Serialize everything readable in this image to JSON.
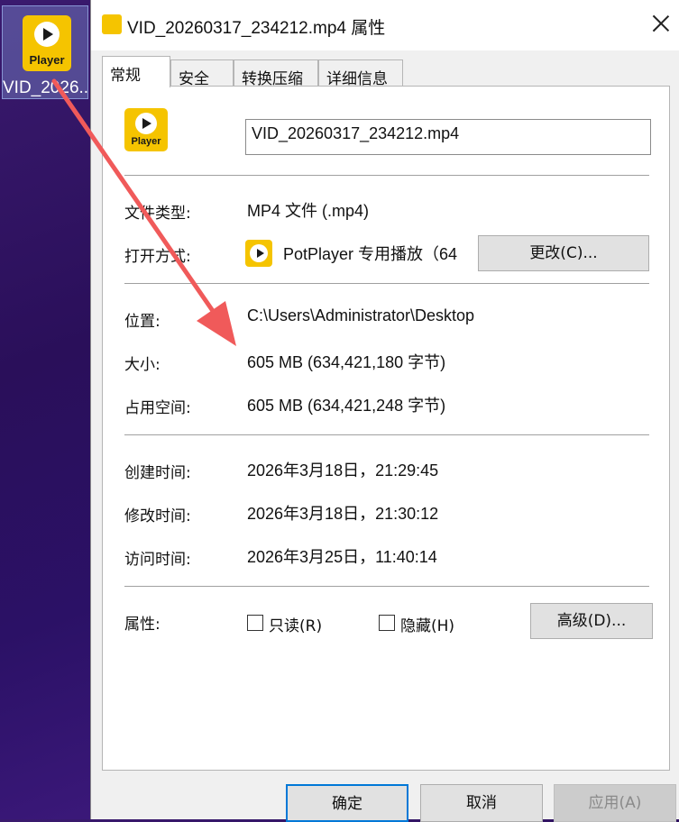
{
  "desktop": {
    "icon_label": "VID_2026..",
    "logo_text": "Player"
  },
  "dialog": {
    "title": "VID_20260317_234212.mp4 属性",
    "tabs": [
      {
        "label": "常规",
        "active": true
      },
      {
        "label": "安全",
        "active": false
      },
      {
        "label": "转换压缩",
        "active": false
      },
      {
        "label": "详细信息",
        "active": false
      }
    ],
    "general": {
      "logo_text": "Player",
      "file_name": "VID_20260317_234212.mp4",
      "file_type_label": "文件类型:",
      "file_type_value": "MP4 文件 (.mp4)",
      "open_with_label": "打开方式:",
      "open_with_value": "PotPlayer 专用播放（64",
      "change_button": "更改(C)...",
      "location_label": "位置:",
      "location_value": "C:\\Users\\Administrator\\Desktop",
      "size_label": "大小:",
      "size_value": "605 MB (634,421,180 字节)",
      "size_on_disk_label": "占用空间:",
      "size_on_disk_value": "605 MB (634,421,248 字节)",
      "created_label": "创建时间:",
      "created_value": "2026年3月18日，21:29:45",
      "modified_label": "修改时间:",
      "modified_value": "2026年3月18日，21:30:12",
      "accessed_label": "访问时间:",
      "accessed_value": "2026年3月25日，11:40:14",
      "attributes_label": "属性:",
      "readonly_label": "只读(R)",
      "hidden_label": "隐藏(H)",
      "advanced_button": "高级(D)..."
    },
    "buttons": {
      "ok": "确定",
      "cancel": "取消",
      "apply": "应用(A)"
    }
  },
  "colors": {
    "accent_yellow": "#f5c400",
    "arrow_red": "#f05a5a",
    "ok_border": "#0078d7"
  }
}
